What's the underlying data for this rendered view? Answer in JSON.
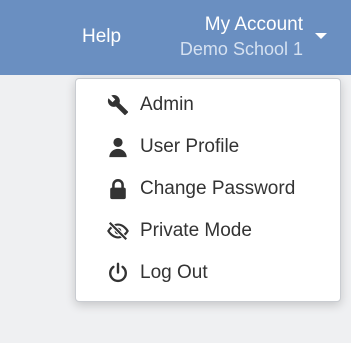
{
  "header": {
    "help_label": "Help",
    "account": {
      "title": "My Account",
      "school": "Demo School 1",
      "caret_icon": "caret-down-icon"
    }
  },
  "account_menu": {
    "items": [
      {
        "label": "Admin",
        "icon": "wrench-icon"
      },
      {
        "label": "User Profile",
        "icon": "user-icon"
      },
      {
        "label": "Change Password",
        "icon": "lock-icon"
      },
      {
        "label": "Private Mode",
        "icon": "eye-slash-icon"
      },
      {
        "label": "Log Out",
        "icon": "power-icon"
      }
    ]
  },
  "colors": {
    "header_bg": "#6a8fc1",
    "page_bg": "#eff0f2",
    "menu_text": "#333333",
    "icon_color": "#333333"
  }
}
